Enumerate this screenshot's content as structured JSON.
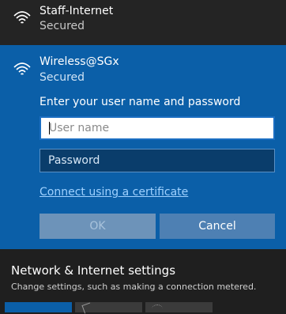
{
  "networks": [
    {
      "ssid": "Staff-Internet",
      "status": "Secured"
    },
    {
      "ssid": "Wireless@SGx",
      "status": "Secured"
    }
  ],
  "auth": {
    "prompt": "Enter your user name and password",
    "username_placeholder": "User name",
    "password_placeholder": "Password",
    "certificate_link": "Connect using a certificate",
    "ok_label": "OK",
    "cancel_label": "Cancel"
  },
  "settings": {
    "title": "Network & Internet settings",
    "subtitle": "Change settings, such as making a connection metered."
  },
  "icons": {
    "wifi": "wifi-signal-icon",
    "airplane": "airplane-mode-icon",
    "hotspot": "mobile-hotspot-icon"
  },
  "colors": {
    "accent": "#0b5fa8",
    "background": "#1f1f1f",
    "link": "#9fd1ff"
  }
}
